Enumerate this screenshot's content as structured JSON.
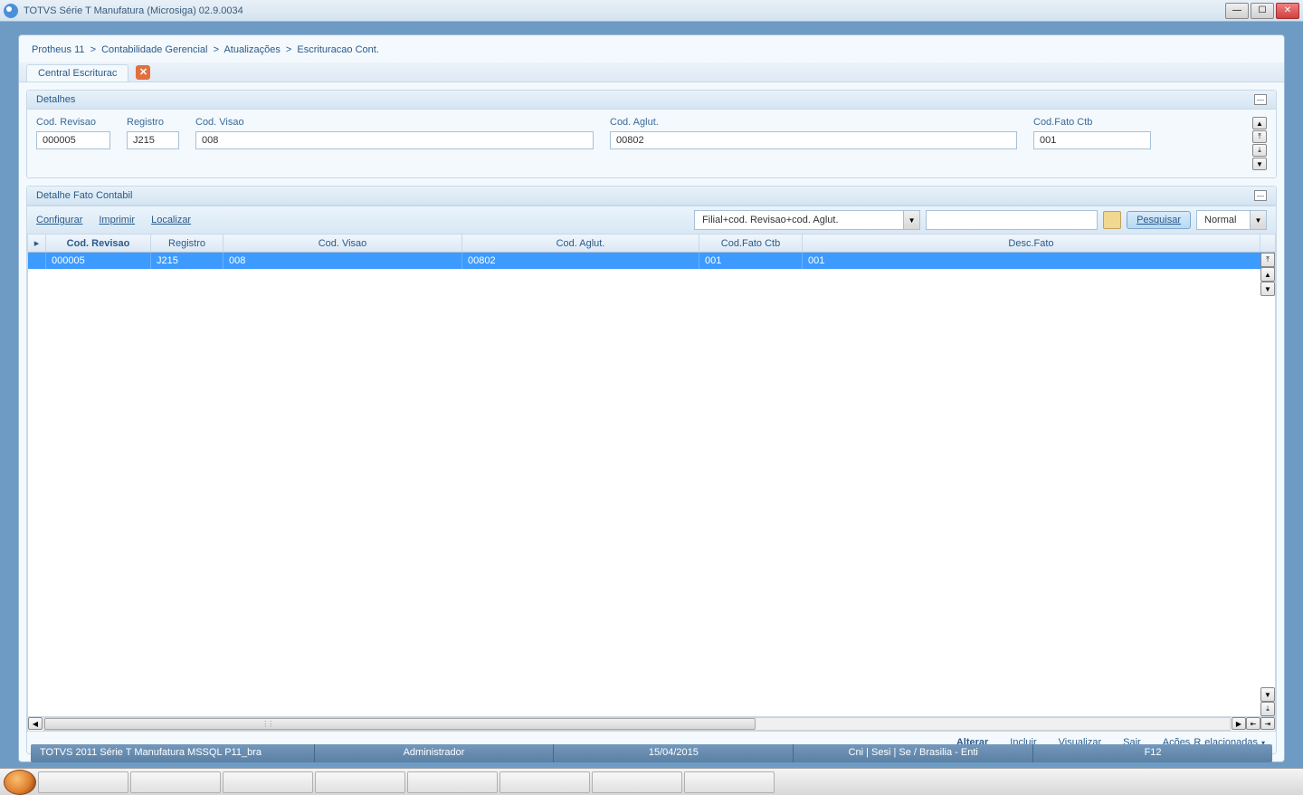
{
  "titlebar": {
    "text": "TOTVS Série T Manufatura (Microsiga) 02.9.0034"
  },
  "breadcrumb": {
    "a": "Protheus 11",
    "b": "Contabilidade Gerencial",
    "c": "Atualizações",
    "d": "Escrituracao Cont."
  },
  "tab": {
    "label": "Central Escriturac"
  },
  "detalhes": {
    "title": "Detalhes",
    "fields": {
      "cod_revisao": {
        "label": "Cod. Revisao",
        "value": "000005"
      },
      "registro": {
        "label": "Registro",
        "value": "J215"
      },
      "cod_visao": {
        "label": "Cod. Visao",
        "value": "008"
      },
      "cod_aglut": {
        "label": "Cod. Aglut.",
        "value": "00802"
      },
      "cod_fato_ctb": {
        "label": "Cod.Fato Ctb",
        "value": "001"
      }
    }
  },
  "detalhe_fato": {
    "title": "Detalhe Fato Contabil"
  },
  "toolbar": {
    "configurar": "Configurar",
    "imprimir": "Imprimir",
    "localizar": "Localizar",
    "filter_combo": "Filial+cod. Revisao+cod. Aglut.",
    "pesquisar": "Pesquisar",
    "mode": "Normal"
  },
  "grid": {
    "headers": {
      "cod_revisao": "Cod. Revisao",
      "registro": "Registro",
      "cod_visao": "Cod. Visao",
      "cod_aglut": "Cod. Aglut.",
      "cod_fato_ctb": "Cod.Fato Ctb",
      "desc_fato": "Desc.Fato"
    },
    "row": {
      "cod_revisao": "000005",
      "registro": "J215",
      "cod_visao": "008",
      "cod_aglut": "00802",
      "cod_fato_ctb": "001",
      "desc_fato": "001"
    }
  },
  "actions": {
    "alterar": "Alterar",
    "incluir": "Incluir",
    "visualizar": "Visualizar",
    "sair": "Sair",
    "acoes_rel": "Ações Relacionadas"
  },
  "status": {
    "product": "TOTVS 2011 Série T Manufatura MSSQL P11_bra",
    "user": "Administrador",
    "date": "15/04/2015",
    "env": "Cni | Sesi | Se / Brasilia - Enti",
    "key": "F12"
  }
}
